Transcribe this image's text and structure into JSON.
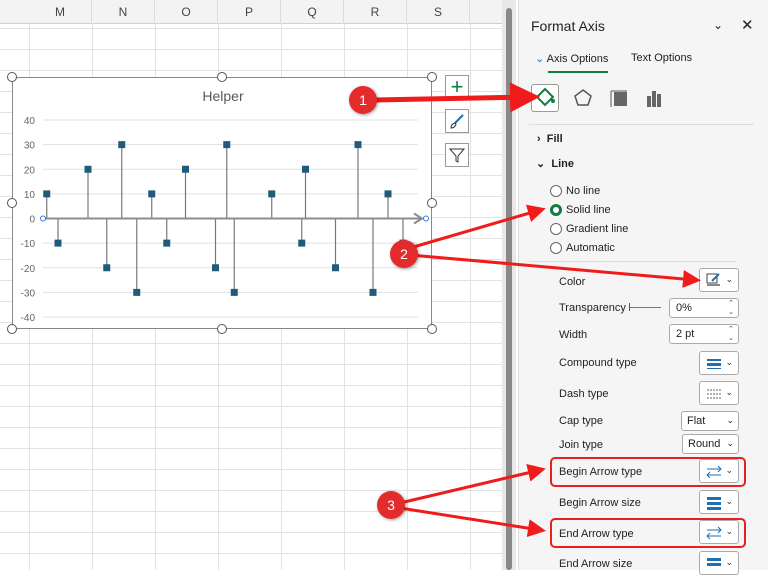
{
  "sheet": {
    "columns": [
      "M",
      "N",
      "O",
      "P",
      "Q",
      "R",
      "S"
    ]
  },
  "chart_data": {
    "type": "scatter",
    "title": "Helper",
    "yticks": [
      "40",
      "30",
      "20",
      "10",
      "0",
      "-10",
      "-20",
      "-30",
      "-40"
    ],
    "ylim": [
      -40,
      40
    ],
    "xlim": [
      0,
      100
    ],
    "grid": true,
    "x": [
      1,
      4,
      12,
      17,
      21,
      25,
      29,
      33,
      38,
      46,
      49,
      51,
      61,
      69,
      70,
      78,
      84,
      88,
      92,
      96
    ],
    "y": [
      10,
      -10,
      20,
      -20,
      30,
      -30,
      10,
      -10,
      20,
      -20,
      30,
      -30,
      10,
      -10,
      20,
      -20,
      30,
      -30,
      10,
      -10
    ],
    "marker_color": "#1f5c7a"
  },
  "panel": {
    "title": "Format Axis",
    "tabs": [
      {
        "label": "Axis Options",
        "active": true
      },
      {
        "label": "Text Options"
      }
    ],
    "sections": {
      "fill": "Fill",
      "line": "Line"
    },
    "radios": [
      {
        "label": "No line"
      },
      {
        "label": "Solid line",
        "checked": true
      },
      {
        "label": "Gradient line"
      },
      {
        "label": "Automatic"
      }
    ],
    "color_label": "Color",
    "transparency": {
      "label": "Transparency",
      "value": "0%"
    },
    "width": {
      "label": "Width",
      "value": "2 pt"
    },
    "compound": "Compound type",
    "dash": "Dash type",
    "cap": {
      "label": "Cap type",
      "value": "Flat"
    },
    "join": {
      "label": "Join type",
      "value": "Round"
    },
    "begin_arrow_type": "Begin Arrow type",
    "begin_arrow_size": "Begin Arrow size",
    "end_arrow_type": "End Arrow type",
    "end_arrow_size": "End Arrow size"
  },
  "callouts": [
    "1",
    "2",
    "3"
  ],
  "accent": "#107c41"
}
